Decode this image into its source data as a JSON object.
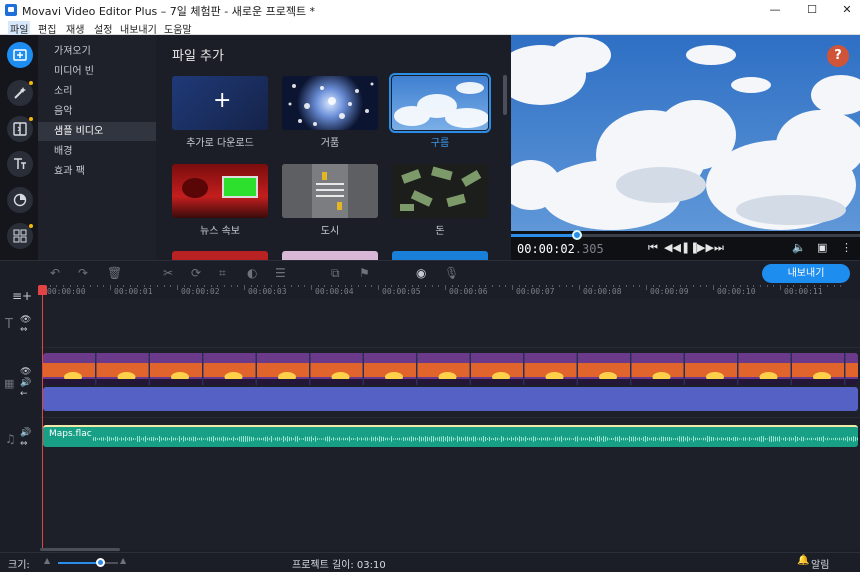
{
  "window": {
    "title": "Movavi Video Editor Plus – 7일 체험판 - 새로운 프로젝트 *",
    "minimize": "—",
    "maximize": "☐",
    "close": "✕"
  },
  "menu": [
    "파일",
    "편집",
    "재생",
    "설정",
    "내보내기",
    "도움말"
  ],
  "sidebar_icons": [
    "import-files-icon",
    "magic-wand-icon",
    "transitions-icon",
    "titles-icon",
    "filters-icon",
    "more-tools-icon"
  ],
  "categories": [
    "가져오기",
    "미디어 빈",
    "소리",
    "음악",
    "샘플 비디오",
    "배경",
    "효과 팩"
  ],
  "active_category": "샘플 비디오",
  "content": {
    "heading": "파일 추가",
    "tiles": [
      {
        "label": "추가로 다운로드",
        "icon": "+"
      },
      {
        "label": "거품"
      },
      {
        "label": "구름",
        "selected": true
      },
      {
        "label": "뉴스 속보"
      },
      {
        "label": "도시"
      },
      {
        "label": "돈"
      }
    ]
  },
  "preview": {
    "help": "?",
    "time_main": "00:00:02",
    "time_ms": ".305",
    "progress": 0.19
  },
  "toolbar": {
    "export_label": "내보내기"
  },
  "ruler_ticks": [
    "00:00:00",
    "00:00:01",
    "00:00:02",
    "00:00:03",
    "00:00:04",
    "00:00:05",
    "00:00:06",
    "00:00:07",
    "00:00:08",
    "00:00:09",
    "00:00:10",
    "00:00:11"
  ],
  "timeline": {
    "audio_clip": "Maps.flac"
  },
  "status": {
    "zoom_label": "크기:",
    "zoom_level": 0.7,
    "project_length": "프로젝트 길이: 03:10",
    "notifications": "알림"
  }
}
